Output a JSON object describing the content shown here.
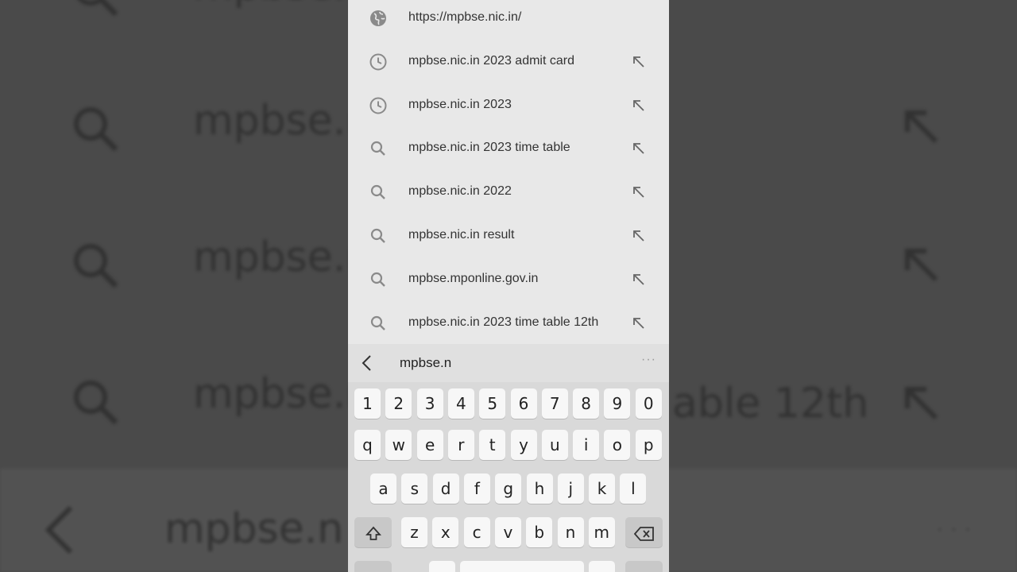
{
  "background": {
    "rows": [
      {
        "text": "mpbse.n"
      },
      {
        "text": "mpbse.n"
      },
      {
        "text": "mpbse.n"
      }
    ],
    "right_fragment": "able 12th",
    "input_text": "mpbse.n"
  },
  "suggestions": [
    {
      "icon": "globe-icon",
      "text": "https://mpbse.nic.in/",
      "has_fill": false
    },
    {
      "icon": "history-icon",
      "text": "mpbse.nic.in 2023 admit card",
      "has_fill": true
    },
    {
      "icon": "history-icon",
      "text": "mpbse.nic.in 2023",
      "has_fill": true
    },
    {
      "icon": "search-icon",
      "text": "mpbse.nic.in 2023 time table",
      "has_fill": true
    },
    {
      "icon": "search-icon",
      "text": "mpbse.nic.in 2022",
      "has_fill": true
    },
    {
      "icon": "search-icon",
      "text": "mpbse.nic.in result",
      "has_fill": true
    },
    {
      "icon": "search-icon",
      "text": "mpbse.mponline.gov.in",
      "has_fill": true
    },
    {
      "icon": "search-icon",
      "text": "mpbse.nic.in 2023 time table 12th",
      "has_fill": true
    }
  ],
  "toolbar": {
    "typed_text": "mpbse.n",
    "more_label": "···"
  },
  "keyboard": {
    "numbers": [
      "1",
      "2",
      "3",
      "4",
      "5",
      "6",
      "7",
      "8",
      "9",
      "0"
    ],
    "row1": [
      "q",
      "w",
      "e",
      "r",
      "t",
      "y",
      "u",
      "i",
      "o",
      "p"
    ],
    "row2": [
      "a",
      "s",
      "d",
      "f",
      "g",
      "h",
      "j",
      "k",
      "l"
    ],
    "row3": [
      "z",
      "x",
      "c",
      "v",
      "b",
      "n",
      "m"
    ]
  }
}
